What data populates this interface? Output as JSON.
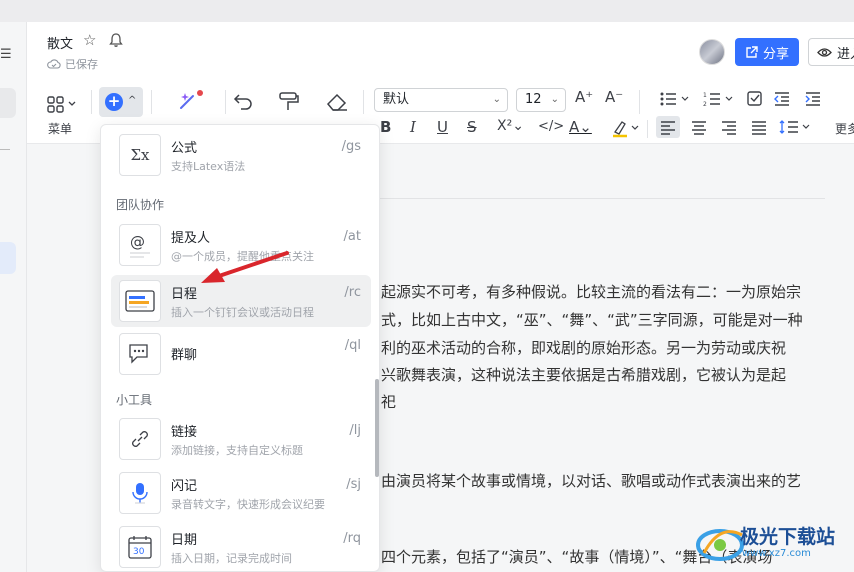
{
  "header": {
    "doc_title": "散文",
    "save_status": "已保存",
    "share_label": "分享",
    "enter_label": "进入"
  },
  "toolbar": {
    "menu_label": "菜单",
    "font_family": "默认",
    "font_size": "12",
    "more_label": "更多"
  },
  "panel": {
    "sections": {
      "team": "团队协作",
      "tools": "小工具"
    },
    "items": [
      {
        "name": "公式",
        "desc": "支持Latex语法",
        "shortcut": "/gs",
        "icon": "formula-icon"
      },
      {
        "name": "提及人",
        "desc": "@一个成员，提醒他重点关注",
        "shortcut": "/at",
        "icon": "mention-icon"
      },
      {
        "name": "日程",
        "desc": "插入一个钉钉会议或活动日程",
        "shortcut": "/rc",
        "icon": "schedule-icon"
      },
      {
        "name": "群聊",
        "desc": "",
        "shortcut": "/ql",
        "icon": "group-chat-icon"
      },
      {
        "name": "链接",
        "desc": "添加链接，支持自定义标题",
        "shortcut": "/lj",
        "icon": "link-icon"
      },
      {
        "name": "闪记",
        "desc": "录音转文字，快速形成会议纪要",
        "shortcut": "/sj",
        "icon": "flash-note-icon"
      },
      {
        "name": "日期",
        "desc": "插入日期，记录完成时间",
        "shortcut": "/rq",
        "icon": "date-icon"
      }
    ]
  },
  "document": {
    "lines": [
      "起源实不可考，有多种假说。比较主流的看法有二：一为原始宗",
      "式，比如上古中文，“巫”、“舞”、“武”三字同源，可能是对一种",
      "利的巫术活动的合称，即戏剧的原始形态。另一为劳动或庆祝",
      "兴歌舞表演，这种说法主要依据是古希腊戏剧，它被认为是起",
      "祀",
      "由演员将某个故事或情境，以对话、歌唱或动作式表演出来的艺",
      "四个元素，包括了“演员”、“故事（情境）”、“舞台（表演场"
    ]
  },
  "watermark": {
    "title": "极光下载站",
    "url": "www.xz7.com"
  },
  "colors": {
    "accent": "#3370ff",
    "arrow": "#d9262c"
  }
}
